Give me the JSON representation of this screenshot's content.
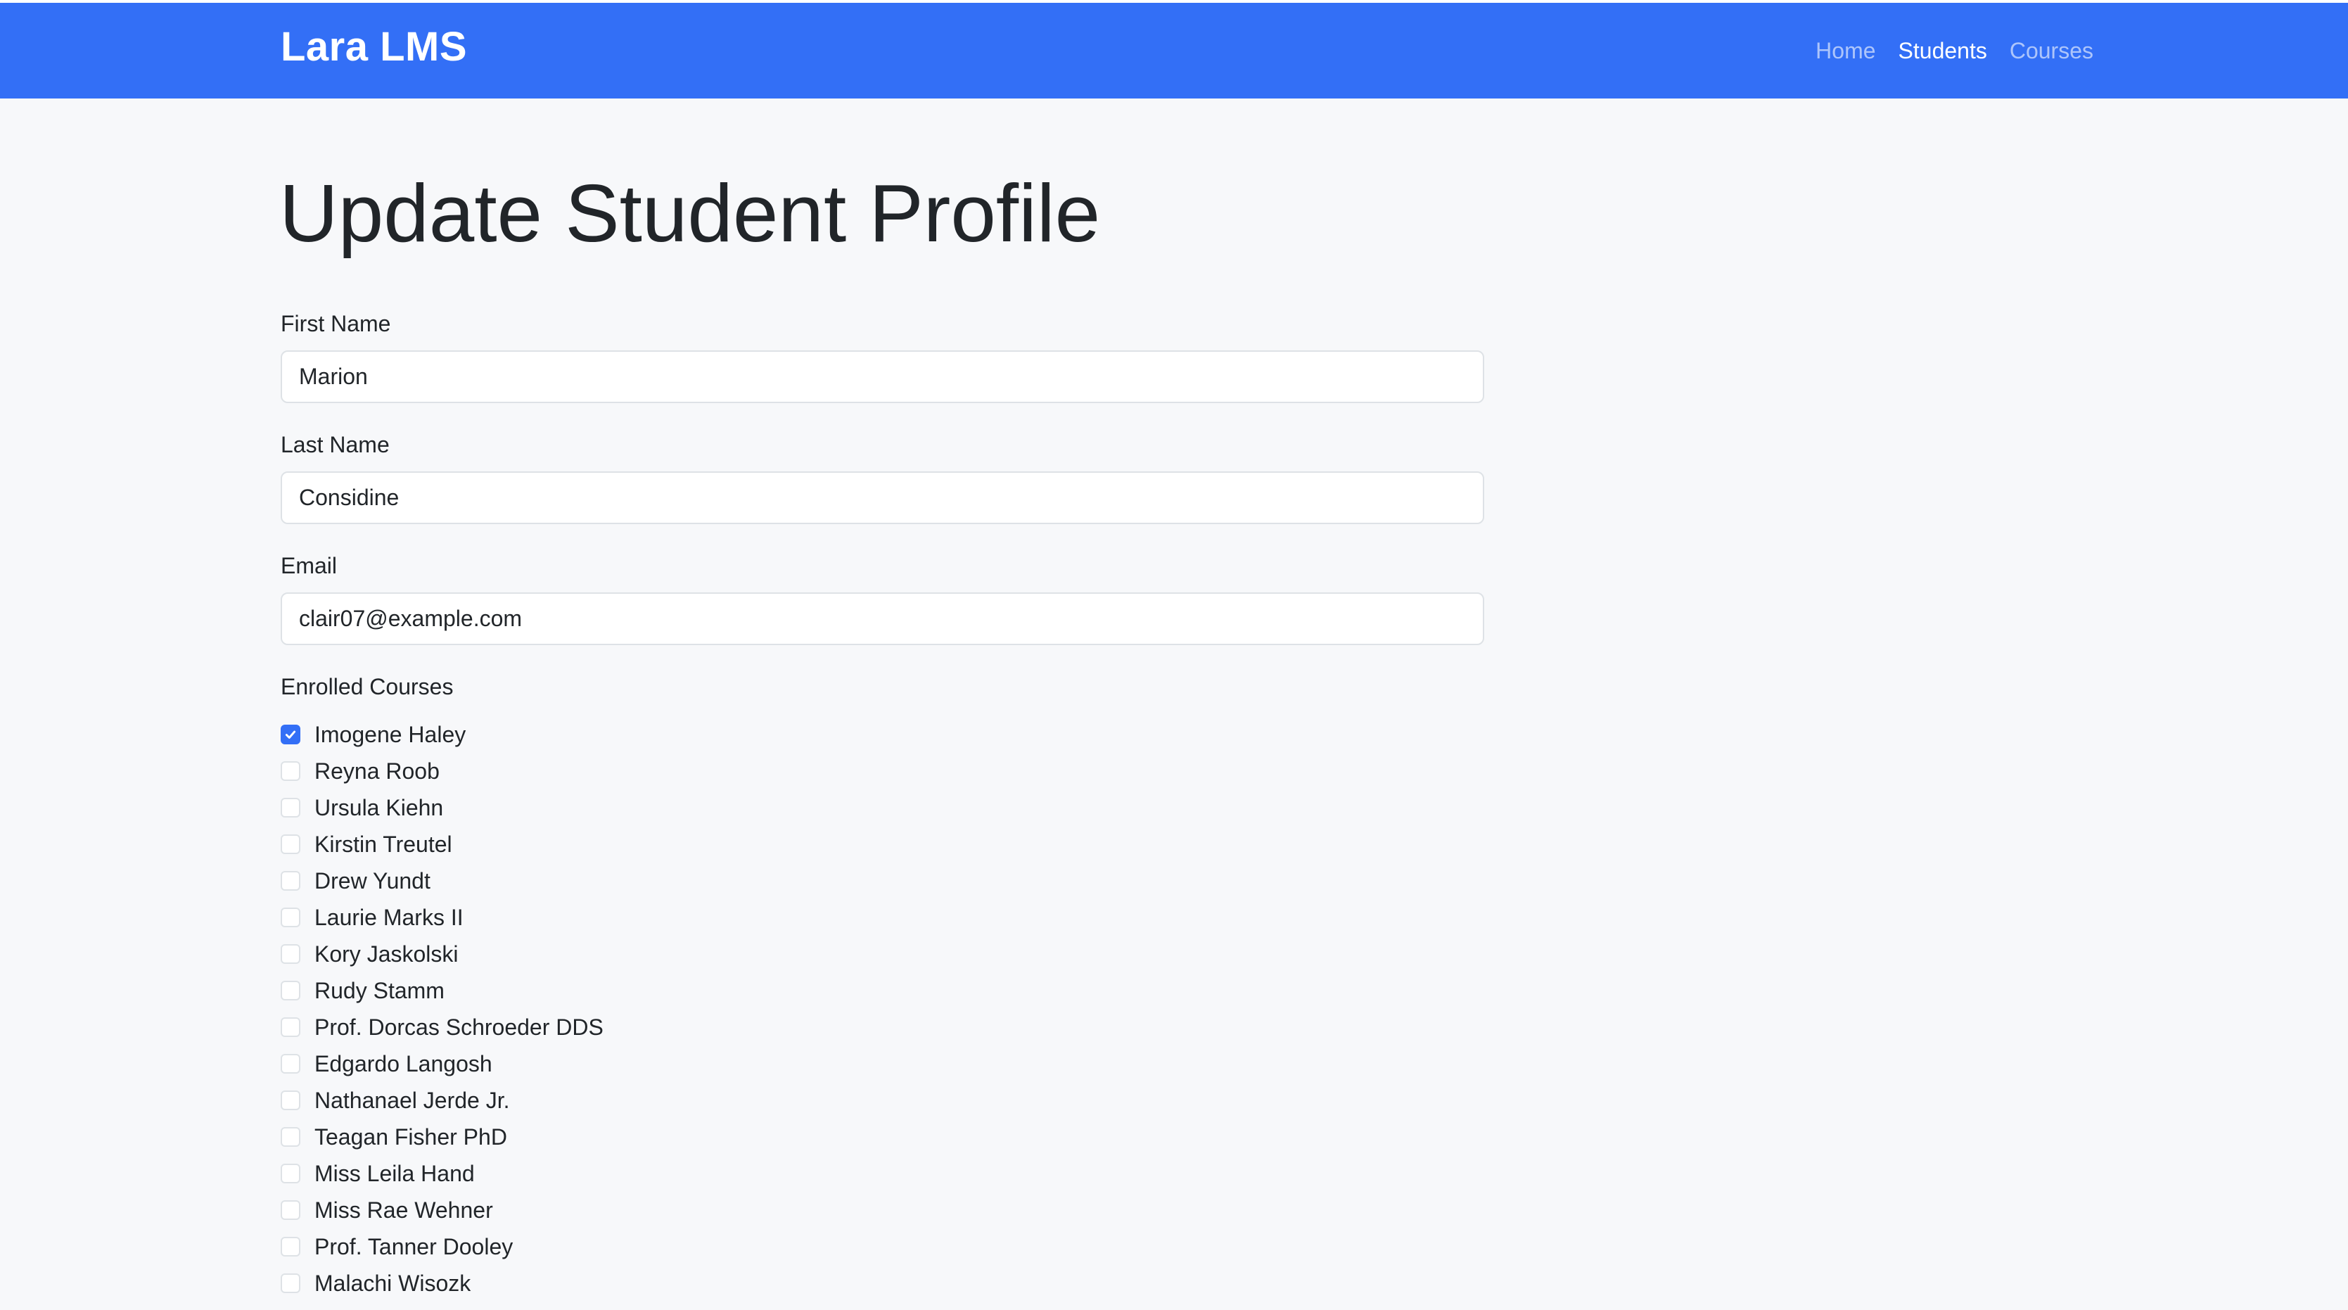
{
  "navbar": {
    "brand": "Lara LMS",
    "links": [
      {
        "label": "Home",
        "active": false
      },
      {
        "label": "Students",
        "active": true
      },
      {
        "label": "Courses",
        "active": false
      }
    ]
  },
  "page": {
    "title": "Update Student Profile"
  },
  "form": {
    "first_name": {
      "label": "First Name",
      "value": "Marion"
    },
    "last_name": {
      "label": "Last Name",
      "value": "Considine"
    },
    "email": {
      "label": "Email",
      "value": "clair07@example.com"
    },
    "courses": {
      "label": "Enrolled Courses",
      "items": [
        {
          "label": "Imogene Haley",
          "checked": true
        },
        {
          "label": "Reyna Roob",
          "checked": false
        },
        {
          "label": "Ursula Kiehn",
          "checked": false
        },
        {
          "label": "Kirstin Treutel",
          "checked": false
        },
        {
          "label": "Drew Yundt",
          "checked": false
        },
        {
          "label": "Laurie Marks II",
          "checked": false
        },
        {
          "label": "Kory Jaskolski",
          "checked": false
        },
        {
          "label": "Rudy Stamm",
          "checked": false
        },
        {
          "label": "Prof. Dorcas Schroeder DDS",
          "checked": false
        },
        {
          "label": "Edgardo Langosh",
          "checked": false
        },
        {
          "label": "Nathanael Jerde Jr.",
          "checked": false
        },
        {
          "label": "Teagan Fisher PhD",
          "checked": false
        },
        {
          "label": "Miss Leila Hand",
          "checked": false
        },
        {
          "label": "Miss Rae Wehner",
          "checked": false
        },
        {
          "label": "Prof. Tanner Dooley",
          "checked": false
        },
        {
          "label": "Malachi Wisozk",
          "checked": false
        }
      ]
    }
  },
  "colors": {
    "primary": "#336ff6",
    "background": "#f7f8fa",
    "input_border": "#dee2e6",
    "text": "#212529"
  }
}
